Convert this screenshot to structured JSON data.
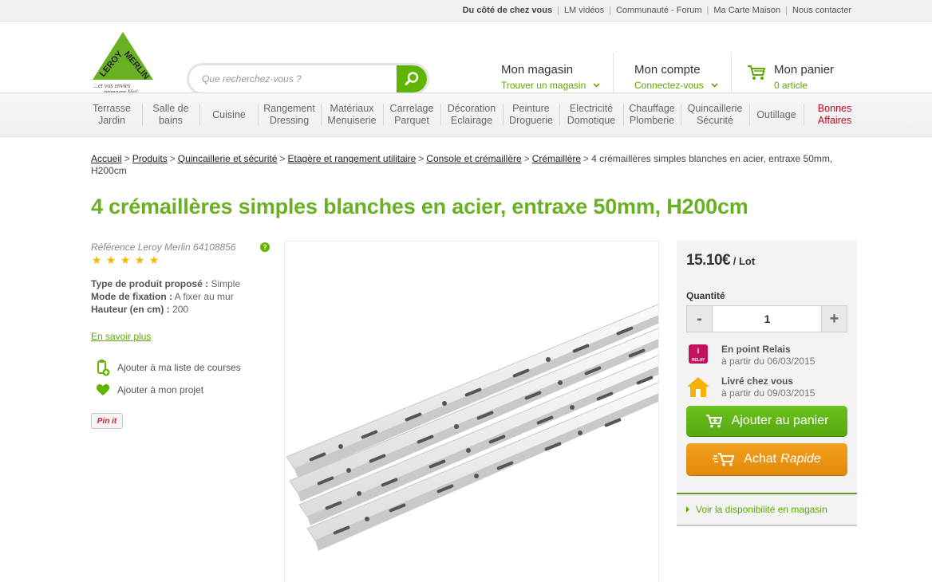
{
  "topbar": {
    "links": [
      "Du côté de chez vous",
      "LM vidéos",
      "Communauté - Forum",
      "Ma Carte Maison",
      "Nous contacter"
    ]
  },
  "header": {
    "logo_text": "LEROY MERLIN",
    "logo_tagline": "...et vos envies prennent Vie!",
    "search_placeholder": "Que recherchez-vous ?",
    "store": {
      "title": "Mon magasin",
      "sub": "Trouver un magasin"
    },
    "account": {
      "title": "Mon compte",
      "sub": "Connectez-vous"
    },
    "cart": {
      "title": "Mon panier",
      "sub": "0 article"
    }
  },
  "nav": {
    "items": [
      {
        "l1": "Terrasse",
        "l2": "Jardin"
      },
      {
        "l1": "Salle de",
        "l2": "bains"
      },
      {
        "l1": "Cuisine",
        "l2": ""
      },
      {
        "l1": "Rangement",
        "l2": "Dressing"
      },
      {
        "l1": "Matériaux",
        "l2": "Menuiserie"
      },
      {
        "l1": "Carrelage",
        "l2": "Parquet"
      },
      {
        "l1": "Décoration",
        "l2": "Eclairage"
      },
      {
        "l1": "Peinture",
        "l2": "Droguerie"
      },
      {
        "l1": "Electricité",
        "l2": "Domotique"
      },
      {
        "l1": "Chauffage",
        "l2": "Plomberie"
      },
      {
        "l1": "Quincaillerie",
        "l2": "Sécurité"
      },
      {
        "l1": "Outillage",
        "l2": ""
      },
      {
        "l1": "Bonnes",
        "l2": "Affaires"
      }
    ],
    "highlight_color": "#c8001e"
  },
  "breadcrumb": {
    "links": [
      "Accueil",
      "Produits",
      "Quincaillerie et sécurité",
      "Etagère et rangement utilitaire",
      "Console et crémaillère",
      "Crémaillère"
    ],
    "current": "4 crémaillères simples blanches en acier, entraxe 50mm, H200cm"
  },
  "product": {
    "title": "4 crémaillères simples blanches en acier, entraxe 50mm, H200cm",
    "reference": "Référence Leroy Merlin 64108856",
    "rating": 5,
    "props": [
      {
        "label": "Type de produit proposé :",
        "value": "Simple"
      },
      {
        "label": "Mode de fixation :",
        "value": "A fixer au mur"
      },
      {
        "label": "Hauteur (en cm) :",
        "value": "200"
      }
    ],
    "more_link": "En savoir plus",
    "add_to_list": "Ajouter à ma liste de courses",
    "add_to_project": "Ajouter à mon projet",
    "pinit": "Pin it"
  },
  "buy": {
    "price": "15.10€",
    "price_unit": " / Lot",
    "qty_label": "Quantité",
    "qty_value": "1",
    "minus": "-",
    "plus": "+",
    "relay_title": "En point Relais",
    "relay_date": "à partir du 06/03/2015",
    "relay_badge": "RELAY",
    "home_title": "Livré chez vous",
    "home_date": "à partir du 09/03/2015",
    "add_to_cart": "Ajouter au panier",
    "quick_1": "Achat",
    "quick_2": "Rapide",
    "availability": "Voir la disponibilité en magasin"
  },
  "colors": {
    "brand_green": "#5fb400",
    "title_green": "#6ab023",
    "cta_orange": "#e98f10",
    "relay_pink": "#c4125f",
    "house_yellow": "#f3b300"
  }
}
